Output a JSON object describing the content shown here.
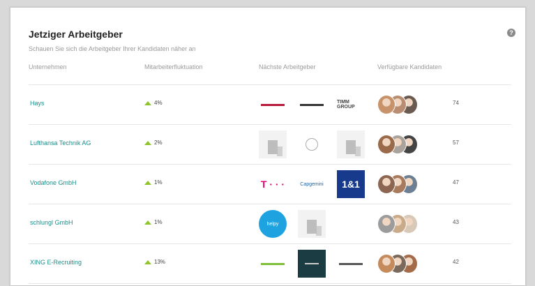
{
  "title": "Jetziger Arbeitgeber",
  "subtitle": "Schauen Sie sich die Arbeitgeber Ihrer Kandidaten näher an",
  "help_icon": "help-icon",
  "headers": {
    "company": "Unternehmen",
    "fluctuation": "Mitarbeiterfluktuation",
    "next_employer": "Nächste Arbeitgeber",
    "candidates": "Verfügbare Kandidaten"
  },
  "colors": {
    "accent_teal": "#1a8f8a",
    "trend_up": "#8ec52d"
  },
  "rows": [
    {
      "company": "Hays",
      "fluctuation": "4%",
      "count": "74",
      "logos": [
        {
          "type": "strip",
          "color": "#b7193a"
        },
        {
          "type": "strip",
          "color": "#333333"
        },
        {
          "type": "text",
          "label": "TIMM GROUP"
        }
      ],
      "avatars": [
        "#c8936a",
        "#b98d72",
        "#6b5a50"
      ]
    },
    {
      "company": "Lufthansa Technik AG",
      "fluctuation": "2%",
      "count": "57",
      "logos": [
        {
          "type": "building"
        },
        {
          "type": "circle"
        },
        {
          "type": "building"
        }
      ],
      "avatars": [
        "#9a6a4a",
        "#a9a39c",
        "#444444"
      ]
    },
    {
      "company": "Vodafone GmbH",
      "fluctuation": "1%",
      "count": "47",
      "logos": [
        {
          "type": "telekom",
          "label": "T · · ·"
        },
        {
          "type": "capgemini",
          "label": "Capgemini"
        },
        {
          "type": "one",
          "label": "1&1"
        }
      ],
      "avatars": [
        "#8c6650",
        "#a87b5e",
        "#6d7f94"
      ]
    },
    {
      "company": "schlungl GmbH",
      "fluctuation": "1%",
      "count": "43",
      "logos": [
        {
          "type": "bubble",
          "label": "helpy"
        },
        {
          "type": "building"
        }
      ],
      "avatars": [
        "#9c9c9c",
        "#c9ab8a",
        "#d8c8b8"
      ]
    },
    {
      "company": "XING E-Recruiting",
      "fluctuation": "13%",
      "count": "42",
      "logos": [
        {
          "type": "strip",
          "color": "#7fbf3a"
        },
        {
          "type": "dark"
        },
        {
          "type": "strip",
          "color": "#555555"
        }
      ],
      "avatars": [
        "#c58b5c",
        "#7b6a5b",
        "#a46b4a"
      ]
    }
  ]
}
